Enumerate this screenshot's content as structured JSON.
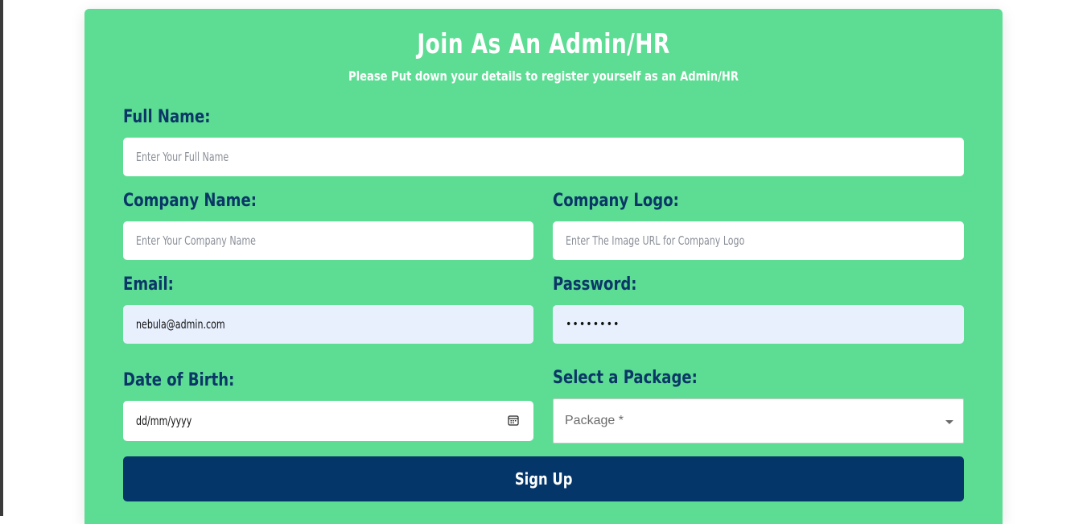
{
  "form": {
    "title": "Join As An Admin/HR",
    "subtitle": "Please Put down your details to register yourself as an Admin/HR",
    "full_name": {
      "label": "Full Name:",
      "placeholder": "Enter Your Full Name",
      "value": ""
    },
    "company_name": {
      "label": "Company Name:",
      "placeholder": "Enter Your Company Name",
      "value": ""
    },
    "company_logo": {
      "label": "Company Logo:",
      "placeholder": "Enter The Image URL for Company Logo",
      "value": ""
    },
    "email": {
      "label": "Email:",
      "value": "nebula@admin.com"
    },
    "password": {
      "label": "Password:",
      "value": "••••••••"
    },
    "dob": {
      "label": "Date of Birth:",
      "value": "dd/mm/yyyy",
      "icon": "calendar-icon"
    },
    "package": {
      "label": "Select a Package:",
      "placeholder": "Package *",
      "icon": "chevron-down-icon"
    },
    "submit_label": "Sign Up"
  },
  "colors": {
    "card_bg": "#5ddd93",
    "label": "#0b3767",
    "button_bg": "#04366a",
    "autofill_bg": "#e8f0fe"
  }
}
